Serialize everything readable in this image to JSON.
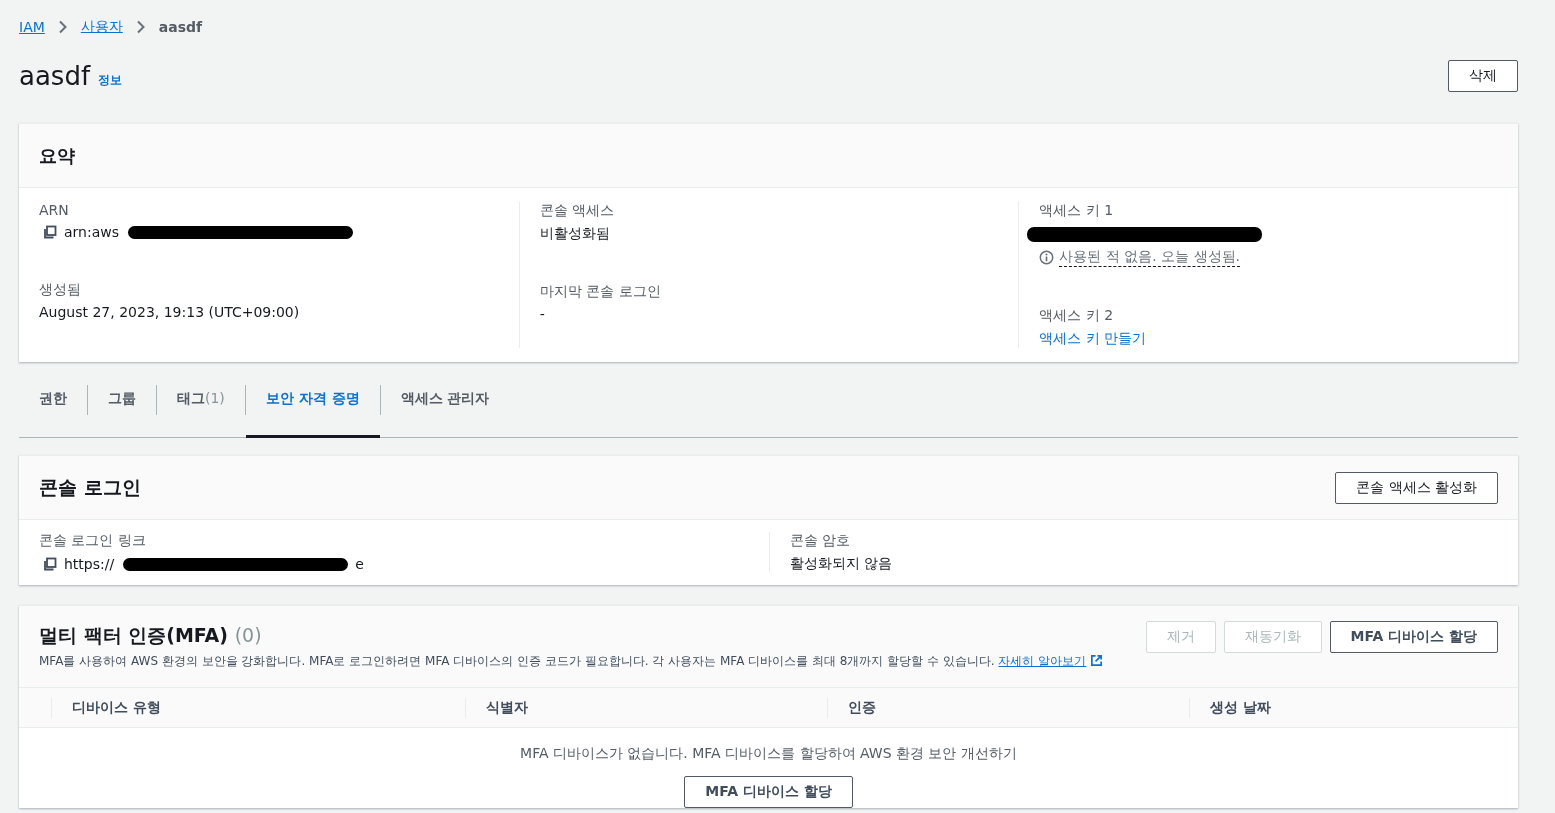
{
  "breadcrumbs": [
    {
      "label": "IAM",
      "kind": "link"
    },
    {
      "label": "사용자",
      "kind": "link"
    },
    {
      "label": "aasdf",
      "kind": "current"
    }
  ],
  "page_title": "aasdf",
  "info_link": "정보",
  "delete_button": "삭제",
  "summary": {
    "title": "요약",
    "columns": [
      [
        {
          "label": "ARN",
          "value": "arn:aws",
          "kind": "copy",
          "redacted": true
        },
        {
          "label": "생성됨",
          "value": "August 27, 2023, 19:13 (UTC+09:00)",
          "kind": "text"
        }
      ],
      [
        {
          "label": "콘솔 액세스",
          "value": "비활성화됨",
          "kind": "text"
        },
        {
          "label": "마지막 콘솔 로그인",
          "value": "-",
          "kind": "text"
        }
      ],
      [
        {
          "label": "액세스 키 1",
          "kind": "redacted",
          "redacted": true,
          "note": "사용된 적 없음. 오늘 생성됨."
        },
        {
          "label": "액세스 키 2",
          "value": "액세스 키 만들기",
          "kind": "link"
        }
      ]
    ]
  },
  "tabs": [
    {
      "label": "권한",
      "selected": false
    },
    {
      "label": "그룹",
      "selected": false
    },
    {
      "label": "태그",
      "count": "(1)",
      "selected": false
    },
    {
      "label": "보안 자격 증명",
      "selected": true
    },
    {
      "label": "액세스 관리자",
      "selected": false
    }
  ],
  "console_login": {
    "title": "콘솔 로그인",
    "button": "콘솔 액세스 활성화",
    "fields": [
      {
        "label": "콘솔 로그인 링크",
        "value": "https://",
        "tail": "e",
        "kind": "copy",
        "redacted": true
      },
      {
        "label": "콘솔 암호",
        "value": "활성화되지 않음",
        "kind": "text"
      }
    ]
  },
  "mfa": {
    "title": "멀티 팩터 인증(MFA)",
    "count": "(0)",
    "description": "MFA를 사용하여 AWS 환경의 보안을 강화합니다. MFA로 로그인하려면 MFA 디바이스의 인증 코드가 필요합니다. 각 사용자는 MFA 디바이스를 최대 8개까지 할당할 수 있습니다.",
    "learn_more": "자세히 알아보기",
    "buttons": [
      {
        "label": "제거",
        "disabled": true,
        "kind": "normal"
      },
      {
        "label": "재동기화",
        "disabled": true,
        "kind": "normal"
      },
      {
        "label": "MFA 디바이스 할당",
        "disabled": false,
        "kind": "normal"
      }
    ],
    "table": {
      "columns": [
        "디바이스 유형",
        "식별자",
        "인증",
        "생성 날짜"
      ],
      "empty_message": "MFA 디바이스가 없습니다. MFA 디바이스를 할당하여 AWS 환경 보안 개선하기",
      "empty_button": "MFA 디바이스 할당"
    }
  }
}
